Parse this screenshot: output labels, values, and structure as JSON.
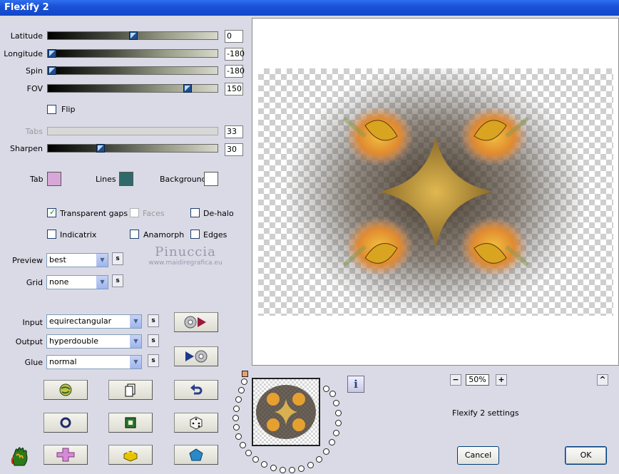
{
  "window": {
    "title": "Flexify 2"
  },
  "sliders": [
    {
      "label": "Latitude",
      "value": "0",
      "level": 0.5
    },
    {
      "label": "Longitude",
      "value": "-180",
      "level": 0.0
    },
    {
      "label": "Spin",
      "value": "-180",
      "level": 0.0
    },
    {
      "label": "FOV",
      "value": "150",
      "level": 0.83
    }
  ],
  "flip": {
    "label": "Flip",
    "checked": false
  },
  "tabs": {
    "label": "Tabs",
    "value": "33",
    "enabled": false
  },
  "sharpen": {
    "label": "Sharpen",
    "value": "30",
    "level": 0.3
  },
  "colors": {
    "tab": {
      "label": "Tab",
      "color": "#d7a7d8"
    },
    "lines": {
      "label": "Lines",
      "color": "#2f6a6a"
    },
    "background": {
      "label": "Background",
      "color": "#ffffff"
    }
  },
  "options": {
    "transparent_gaps": {
      "label": "Transparent gaps",
      "checked": true
    },
    "faces": {
      "label": "Faces",
      "checked": false,
      "enabled": false
    },
    "de_halo": {
      "label": "De-halo",
      "checked": false
    },
    "indicatrix": {
      "label": "Indicatrix",
      "checked": false
    },
    "anamorph": {
      "label": "Anamorph",
      "checked": false
    },
    "edges": {
      "label": "Edges",
      "checked": false
    }
  },
  "preview_select": {
    "label": "Preview",
    "value": "best"
  },
  "grid_select": {
    "label": "Grid",
    "value": "none"
  },
  "input_select": {
    "label": "Input",
    "value": "equirectangular"
  },
  "output_select": {
    "label": "Output",
    "value": "hyperdouble"
  },
  "glue_select": {
    "label": "Glue",
    "value": "normal"
  },
  "s_button_label": "s",
  "watermark": {
    "name": "Pinuccia",
    "url": "www.maidiregrafica.eu"
  },
  "zoom": {
    "value": "50%",
    "minus": "−",
    "plus": "+"
  },
  "collapse_label": "^",
  "info_label": "i",
  "status": {
    "text": "Flexify 2 settings"
  },
  "buttons": {
    "cancel": "Cancel",
    "ok": "OK"
  },
  "icons": {
    "play_to": "disc-play-icon",
    "play_from": "play-disc-icon",
    "row1": [
      "globe-icon",
      "copy-icon",
      "undo-icon"
    ],
    "row2": [
      "circle-icon",
      "square-icon",
      "dice-icon"
    ],
    "row3": [
      "cross-icon",
      "brick-icon",
      "pentagon-icon"
    ],
    "logo": "flaming-hand-icon"
  }
}
